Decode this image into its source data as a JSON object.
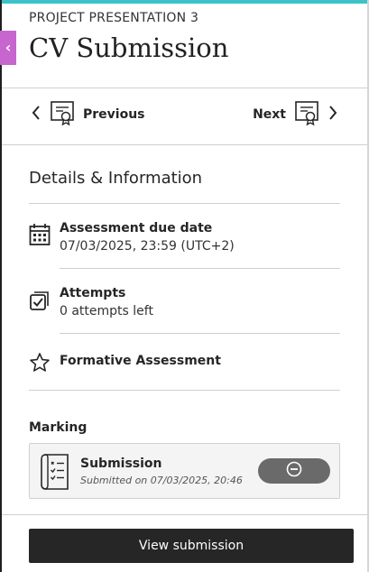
{
  "header": {
    "subtitle": "PROJECT PRESENTATION 3",
    "title": "CV Submission"
  },
  "close_tab": {
    "glyph": "‹",
    "icon": "chevron-left-icon",
    "color": "#c766cf"
  },
  "nav": {
    "previous_label": "Previous",
    "next_label": "Next",
    "prev_icon": "chevron-left-icon",
    "next_icon": "chevron-right-icon",
    "item_icon": "certificate-icon"
  },
  "details": {
    "section_title": "Details & Information",
    "items": [
      {
        "icon": "calendar-icon",
        "label": "Assessment due date",
        "value": "07/03/2025, 23:59 (UTC+2)"
      },
      {
        "icon": "attempts-check-icon",
        "label": "Attempts",
        "value": "0 attempts left"
      },
      {
        "icon": "star-icon",
        "label": "Formative Assessment",
        "value": ""
      }
    ]
  },
  "marking": {
    "title": "Marking",
    "submission": {
      "icon": "checklist-document-icon",
      "name": "Submission",
      "meta": "Submitted on 07/03/2025, 20:46",
      "status_icon": "minus-circle-icon"
    }
  },
  "footer": {
    "view_button": "View submission"
  },
  "colors": {
    "accent": "#3cc2c8",
    "close_tab": "#c766cf",
    "primary_button": "#262626",
    "status_pill": "#6a6a6a",
    "card_bg": "#f4f4f4"
  }
}
